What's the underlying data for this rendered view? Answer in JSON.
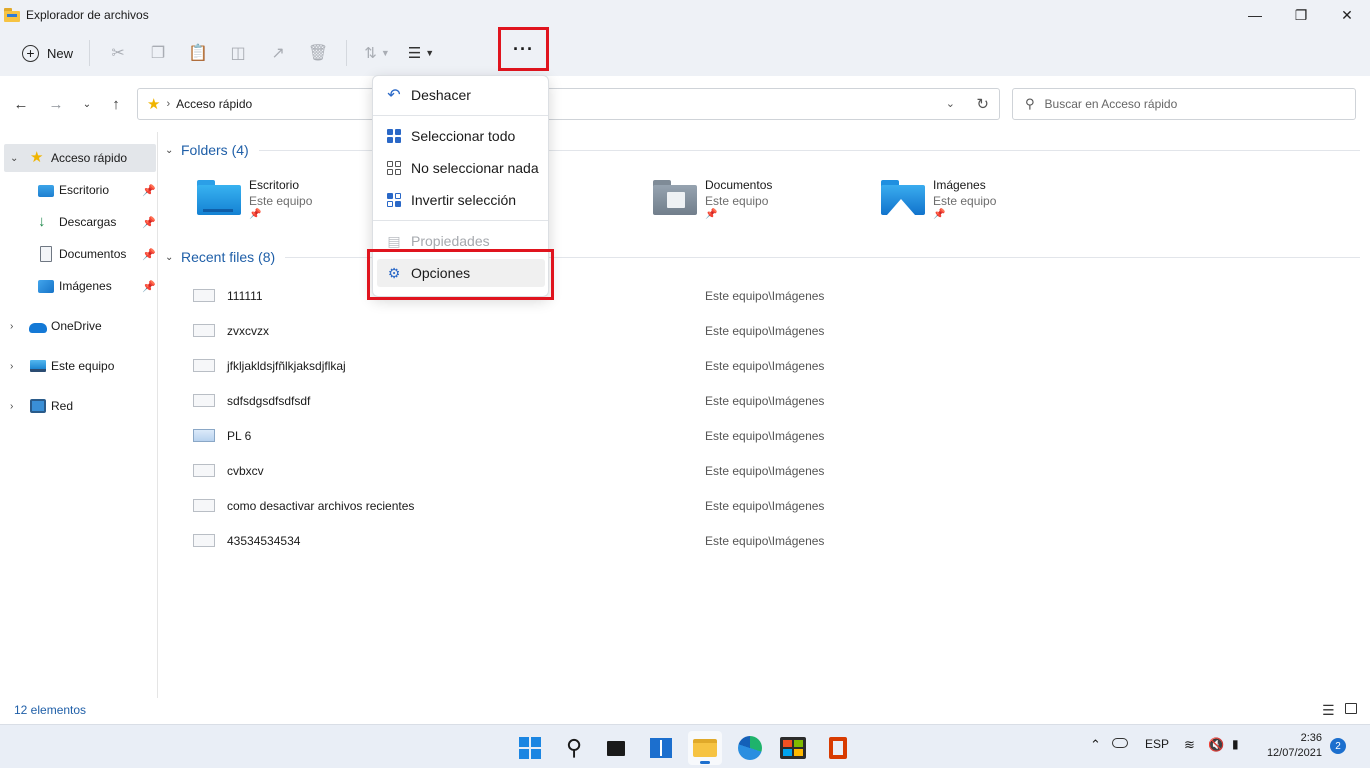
{
  "window": {
    "title": "Explorador de archivos"
  },
  "toolbar": {
    "new_label": "New",
    "more_label": "···"
  },
  "address": {
    "path": "Acceso rápido"
  },
  "search": {
    "placeholder": "Buscar en Acceso rápido"
  },
  "sidebar": {
    "items": [
      {
        "label": "Acceso rápido",
        "icon": "star-icon",
        "active": true
      },
      {
        "label": "Escritorio",
        "icon": "desktop-icon",
        "pinned": true
      },
      {
        "label": "Descargas",
        "icon": "download-icon",
        "pinned": true
      },
      {
        "label": "Documentos",
        "icon": "documents-icon",
        "pinned": true
      },
      {
        "label": "Imágenes",
        "icon": "pictures-icon",
        "pinned": true
      },
      {
        "label": "OneDrive",
        "icon": "onedrive-icon"
      },
      {
        "label": "Este equipo",
        "icon": "pc-icon"
      },
      {
        "label": "Red",
        "icon": "network-icon"
      }
    ]
  },
  "folders": {
    "header": "Folders (4)",
    "items": [
      {
        "name": "Escritorio",
        "location": "Este equipo"
      },
      {
        "name": "Documentos",
        "location": "Este equipo"
      },
      {
        "name": "Imágenes",
        "location": "Este equipo"
      }
    ]
  },
  "recent": {
    "header": "Recent files (8)",
    "items": [
      {
        "name": "111111",
        "location": "Este equipo\\Imágenes"
      },
      {
        "name": "zvxcvzx",
        "location": "Este equipo\\Imágenes"
      },
      {
        "name": "jfkljakldsjfñlkjaksdjflkaj",
        "location": "Este equipo\\Imágenes"
      },
      {
        "name": "sdfsdgsdfsdfsdf",
        "location": "Este equipo\\Imágenes"
      },
      {
        "name": "PL 6",
        "location": "Este equipo\\Imágenes"
      },
      {
        "name": "cvbxcv",
        "location": "Este equipo\\Imágenes"
      },
      {
        "name": "como desactivar archivos recientes",
        "location": "Este equipo\\Imágenes"
      },
      {
        "name": "43534534534",
        "location": "Este equipo\\Imágenes"
      }
    ]
  },
  "menu": {
    "items": [
      {
        "label": "Deshacer",
        "icon": "undo-icon"
      },
      {
        "label": "Seleccionar todo",
        "icon": "select-all-icon"
      },
      {
        "label": "No seleccionar nada",
        "icon": "select-none-icon"
      },
      {
        "label": "Invertir selección",
        "icon": "invert-selection-icon"
      },
      {
        "label": "Propiedades",
        "icon": "properties-icon",
        "disabled": true
      },
      {
        "label": "Opciones",
        "icon": "options-icon"
      }
    ]
  },
  "status": {
    "count": "12 elementos"
  },
  "taskbar": {
    "lang": "ESP",
    "time": "2:36",
    "date": "12/07/2021",
    "notifications": "2"
  },
  "colors": {
    "highlight": "#e0141e",
    "accent": "#1c6fce"
  }
}
